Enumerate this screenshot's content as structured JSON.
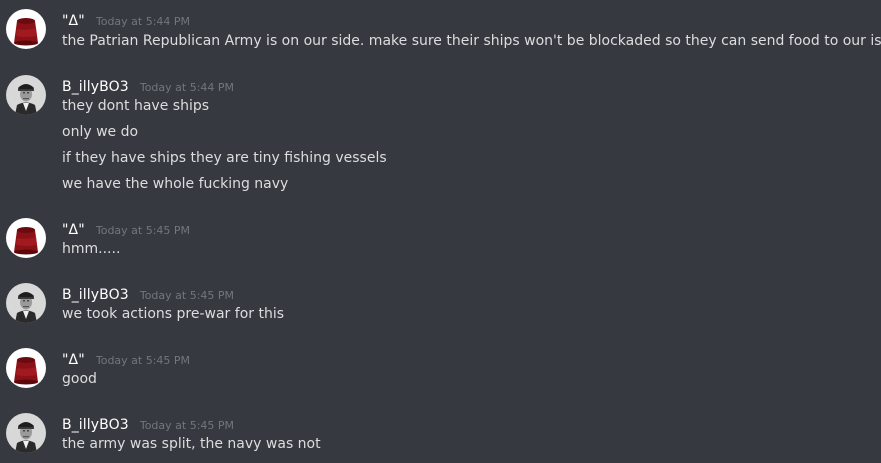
{
  "messages": [
    {
      "author": "\"Δ\"",
      "avatar": "fez-icon",
      "timestamp": "Today at 5:44 PM",
      "lines": [
        "the Patrian  Republican Army is on our side.  make sure their ships won't be blockaded so they can send food to our island"
      ]
    },
    {
      "author": "B_illyBO3",
      "avatar": "officer-portrait-icon",
      "timestamp": "Today at 5:44 PM",
      "lines": [
        "they dont have ships",
        "only we do",
        "if they have ships they are tiny fishing vessels",
        "we have the whole fucking navy"
      ]
    },
    {
      "author": "\"Δ\"",
      "avatar": "fez-icon",
      "timestamp": "Today at 5:45 PM",
      "lines": [
        "hmm....."
      ]
    },
    {
      "author": "B_illyBO3",
      "avatar": "officer-portrait-icon",
      "timestamp": "Today at 5:45 PM",
      "lines": [
        "we took actions pre-war for this"
      ]
    },
    {
      "author": "\"Δ\"",
      "avatar": "fez-icon",
      "timestamp": "Today at 5:45 PM",
      "lines": [
        "good"
      ]
    },
    {
      "author": "B_illyBO3",
      "avatar": "officer-portrait-icon",
      "timestamp": "Today at 5:45 PM",
      "lines": [
        "the army was split, the navy was not"
      ]
    }
  ],
  "colors": {
    "background": "#36393f",
    "username": "#ffffff",
    "timestamp": "#72767d",
    "text": "#dcddde"
  }
}
